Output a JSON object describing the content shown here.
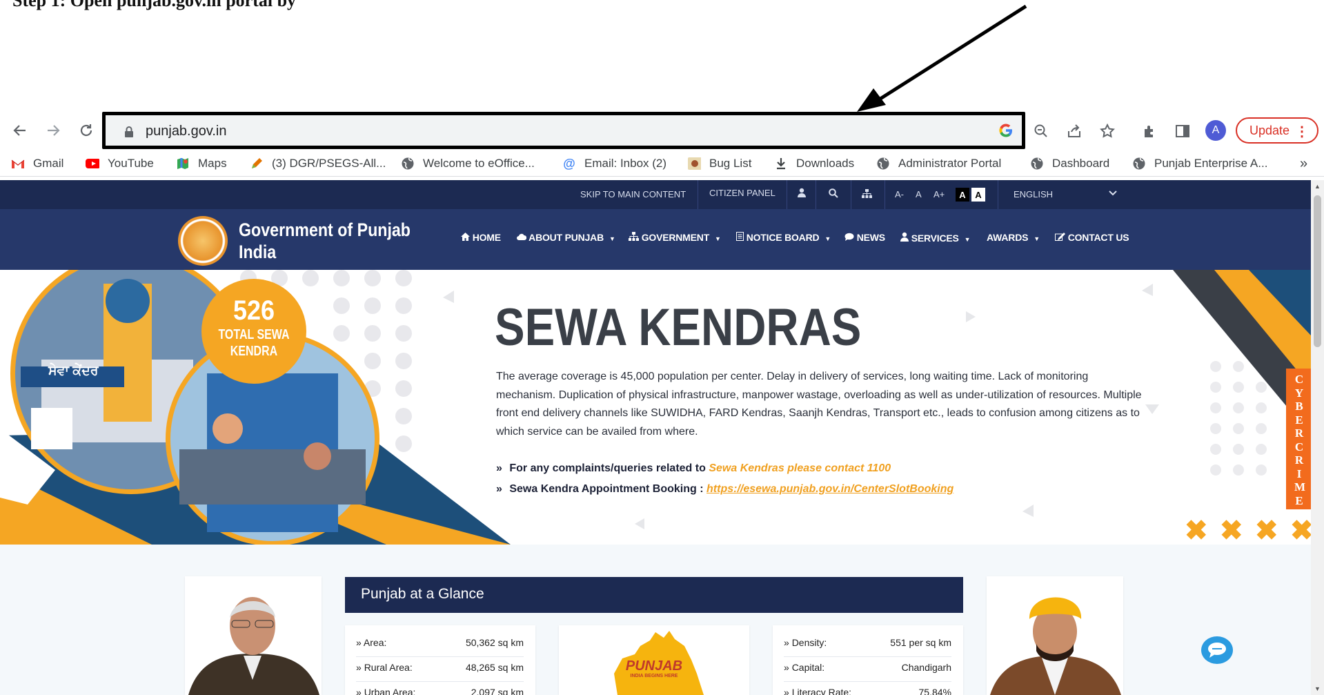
{
  "top_doc": {
    "caption": "Step 1: Open punjab.gov.in portal by"
  },
  "browser": {
    "url": "punjab.gov.in",
    "update_label": "Update",
    "avatar_letter": "A",
    "bookmarks": [
      {
        "label": "Gmail",
        "icon": "gmail-icon"
      },
      {
        "label": "YouTube",
        "icon": "youtube-icon"
      },
      {
        "label": "Maps",
        "icon": "maps-icon"
      },
      {
        "label": "(3) DGR/PSEGS-All...",
        "icon": "pencil-icon"
      },
      {
        "label": "Welcome to eOffice...",
        "icon": "globe-icon"
      },
      {
        "label": "Email: Inbox (2)",
        "icon": "at-icon"
      },
      {
        "label": "Bug List",
        "icon": "bug-icon"
      },
      {
        "label": "Downloads",
        "icon": "download-icon"
      },
      {
        "label": "Administrator Portal",
        "icon": "globe-icon"
      },
      {
        "label": "Dashboard",
        "icon": "globe-icon"
      },
      {
        "label": "Punjab Enterprise A...",
        "icon": "globe-icon"
      }
    ],
    "more_bookmarks": "»"
  },
  "site": {
    "utility": {
      "skip": "SKIP TO MAIN CONTENT",
      "citizen": "CITIZEN PANEL",
      "font_minus": "A-",
      "font_normal": "A",
      "font_plus": "A+",
      "contrast_dark": "A",
      "contrast_light": "A",
      "language": "ENGLISH"
    },
    "title_line1": "Government of Punjab",
    "title_line2": "India",
    "nav": [
      {
        "label": "HOME",
        "icon": "home-icon",
        "caret": false
      },
      {
        "label": "ABOUT PUNJAB",
        "icon": "cloud-icon",
        "caret": true
      },
      {
        "label": "GOVERNMENT",
        "icon": "sitemap-icon",
        "caret": true
      },
      {
        "label": "NOTICE BOARD",
        "icon": "document-icon",
        "caret": true
      },
      {
        "label": "NEWS",
        "icon": "comment-icon",
        "caret": false
      },
      {
        "label": "SERVICES",
        "icon": "user-icon",
        "caret": true
      },
      {
        "label": "AWARDS",
        "icon": "",
        "caret": true
      },
      {
        "label": "CONTACT US",
        "icon": "edit-icon",
        "caret": false
      }
    ],
    "banner": {
      "title": "SEWA KENDRAS",
      "badge_number": "526",
      "badge_line1": "TOTAL SEWA",
      "badge_line2": "KENDRA",
      "building_sign": "ਸੇਵਾ ਕੇਂਦਰ",
      "text": "The average coverage is 45,000 population per center. Delay in delivery of services, long waiting time. Lack of monitoring mechanism. Duplication of physical infrastructure, manpower wastage, overloading as well as under-utilization of resources. Multiple front end delivery channels like SUWIDHA, FARD Kendras, Saanjh Kendras, Transport etc., leads to confusion among citizens as to which service can be availed from where.",
      "complaint_prefix": "For any complaints/queries related to",
      "complaint_highlight": "Sewa Kendras please contact 1100",
      "booking_prefix": "Sewa Kendra Appointment Booking :",
      "booking_link": "https://esewa.punjab.gov.in/CenterSlotBooking",
      "cyber_label": "CYBERCRIME"
    },
    "glance": {
      "title": "Punjab at a Glance",
      "map_label": "PUNJAB",
      "map_sublabel": "INDIA BEGINS HERE",
      "left_stats": [
        {
          "label": "Area:",
          "value": "50,362 sq km"
        },
        {
          "label": "Rural Area:",
          "value": "48,265 sq km"
        },
        {
          "label": "Urban Area:",
          "value": "2,097 sq km"
        }
      ],
      "right_stats": [
        {
          "label": "Density:",
          "value": "551 per sq km"
        },
        {
          "label": "Capital:",
          "value": "Chandigarh"
        },
        {
          "label": "Literacy Rate:",
          "value": "75.84%"
        }
      ]
    }
  }
}
